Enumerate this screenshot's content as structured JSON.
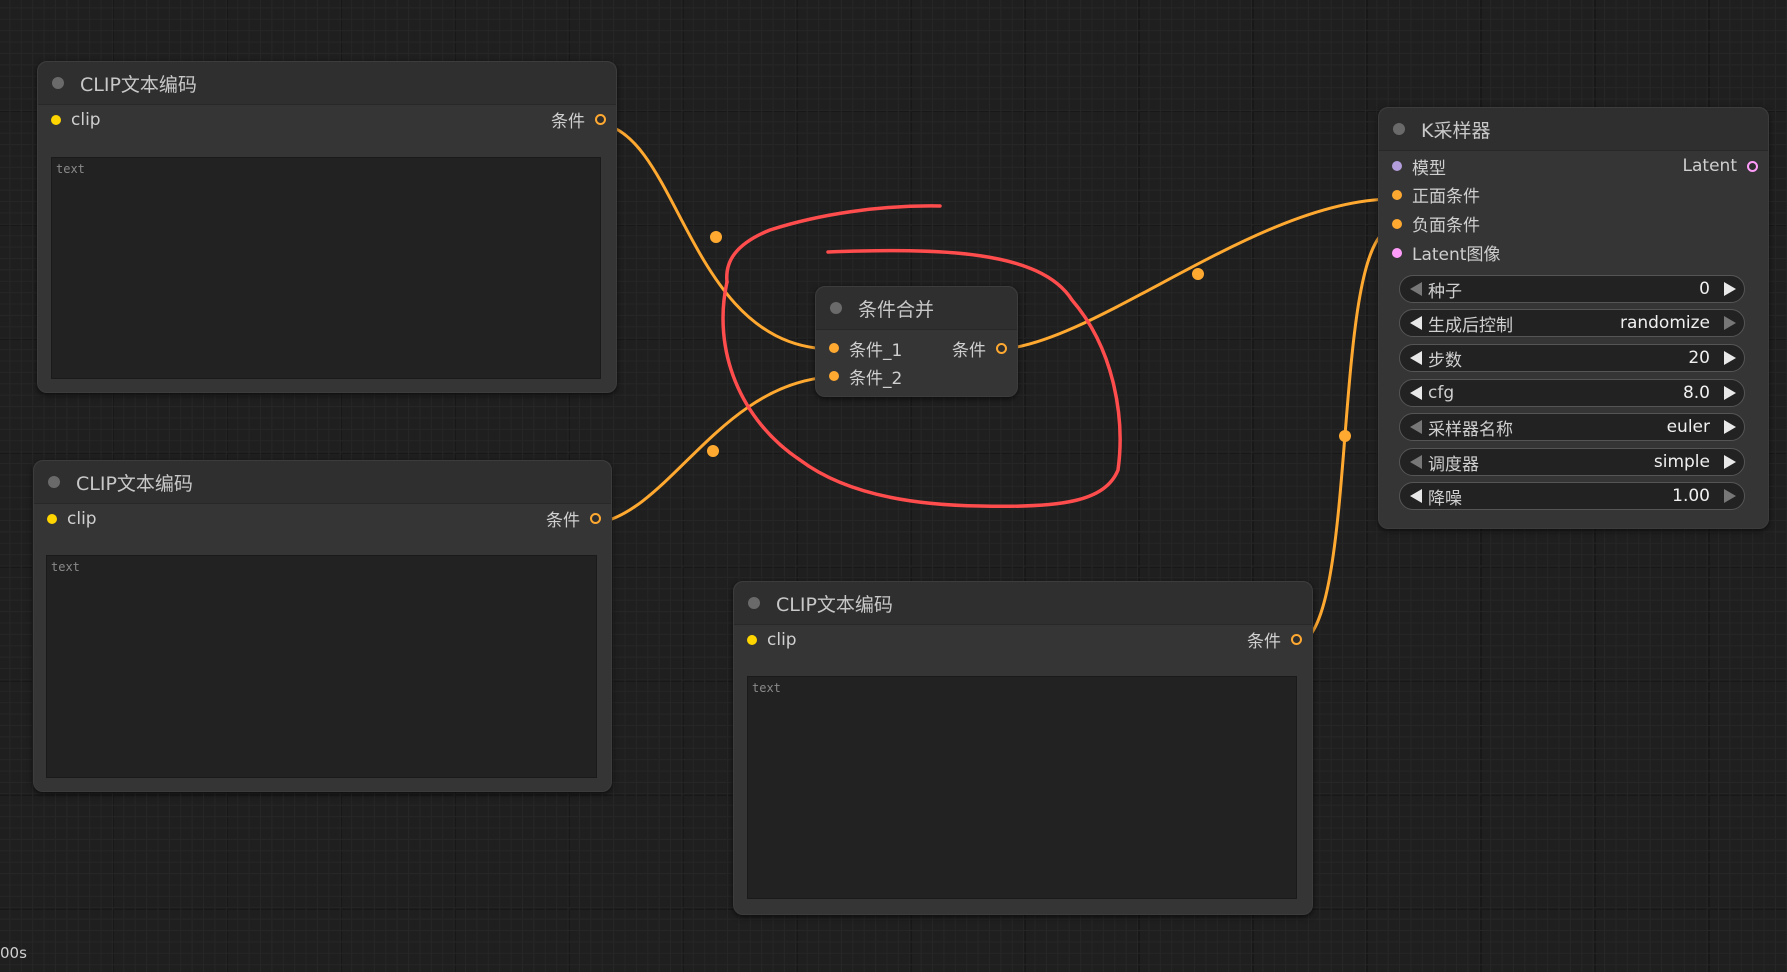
{
  "nodes": {
    "clip1": {
      "title": "CLIP文本编码",
      "input": "clip",
      "output": "条件",
      "placeholder": "text"
    },
    "clip2": {
      "title": "CLIP文本编码",
      "input": "clip",
      "output": "条件",
      "placeholder": "text"
    },
    "clip3": {
      "title": "CLIP文本编码",
      "input": "clip",
      "output": "条件",
      "placeholder": "text"
    },
    "combine": {
      "title": "条件合并",
      "inputs": [
        "条件_1",
        "条件_2"
      ],
      "output": "条件"
    },
    "ksampler": {
      "title": "K采样器",
      "inputs": [
        "模型",
        "正面条件",
        "负面条件",
        "Latent图像"
      ],
      "output": "Latent",
      "widgets": [
        {
          "name": "种子",
          "value": "0"
        },
        {
          "name": "生成后控制",
          "value": "randomize"
        },
        {
          "name": "步数",
          "value": "20"
        },
        {
          "name": "cfg",
          "value": "8.0"
        },
        {
          "name": "采样器名称",
          "value": "euler"
        },
        {
          "name": "调度器",
          "value": "simple"
        },
        {
          "name": "降噪",
          "value": "1.00"
        }
      ]
    }
  },
  "status_text": "00s",
  "colors": {
    "conditioning": "#ffa931",
    "clip": "#ffd500",
    "model": "#b39ddb",
    "latent": "#ff9cf9",
    "annotation": "#ff4d4d"
  }
}
